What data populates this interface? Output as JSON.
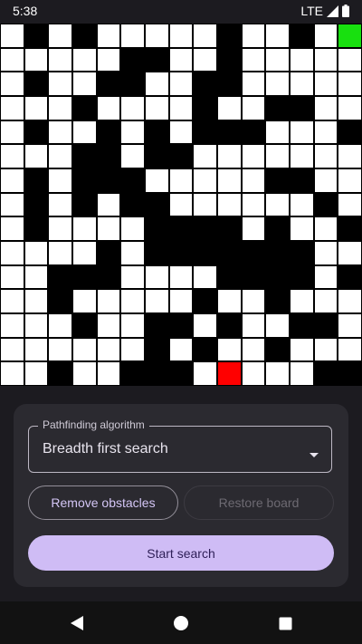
{
  "status_bar": {
    "time": "5:38",
    "network": "LTE",
    "icons": [
      "signal-icon",
      "battery-icon"
    ]
  },
  "grid": {
    "size": 15,
    "colors": {
      "wall": "#000000",
      "open": "#ffffff",
      "start": "#18e00f",
      "end": "#ff0000"
    },
    "rows": [
      "#W#W#####W##W#S",
      "#####WW##W#####",
      "#W##WW##WW#####",
      "###W####W##WW#",
      "#W##W#W#WWW###W",
      "###WW#WW######",
      "#W#WWW#####WW##",
      "#W#W#WW######W",
      "#W####WWWW#W##W",
      "####W#WWWWWWW##",
      "##WWW####WWWW#W",
      "##W#####W##W###",
      "###W##WW#W##WW#",
      "######W#W##W##",
      "##W##WWW#E###WW"
    ],
    "start": {
      "row": 0,
      "col": 14
    },
    "end": {
      "row": 14,
      "col": 9
    }
  },
  "controls": {
    "algorithm_label": "Pathfinding algorithm",
    "algorithm_value": "Breadth first search",
    "remove_obstacles_label": "Remove obstacles",
    "restore_board_label": "Restore board",
    "start_search_label": "Start search",
    "accent_color": "#cfbcf5"
  },
  "nav_bar": {
    "icons": [
      "back-icon",
      "home-icon",
      "recents-icon"
    ]
  }
}
